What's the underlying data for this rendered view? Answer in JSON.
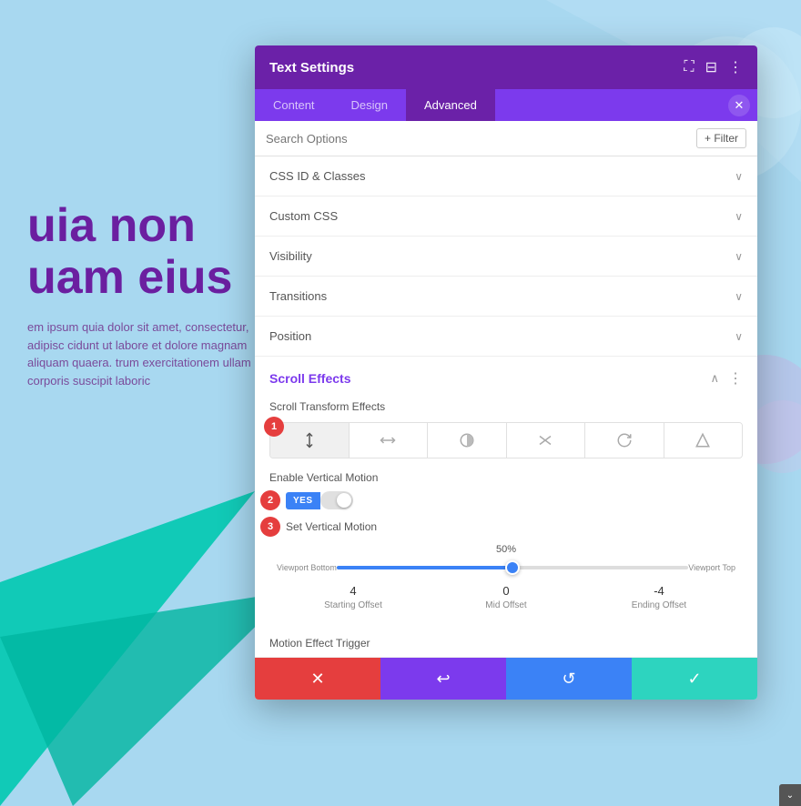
{
  "background": {
    "color": "#a8d8f0"
  },
  "page_text": {
    "heading_line1": "uia non",
    "heading_line2": "uam eius",
    "body": "em ipsum quia dolor sit amet, consectetur, adipisc cidunt ut labore et dolore magnam aliquam quaera. trum exercitationem ullam corporis suscipit laboric"
  },
  "modal": {
    "title": "Text Settings",
    "tabs": [
      {
        "label": "Content",
        "active": false
      },
      {
        "label": "Design",
        "active": false
      },
      {
        "label": "Advanced",
        "active": true
      }
    ],
    "search_placeholder": "Search Options",
    "filter_label": "+ Filter",
    "accordion_sections": [
      {
        "label": "CSS ID & Classes"
      },
      {
        "label": "Custom CSS"
      },
      {
        "label": "Visibility"
      },
      {
        "label": "Transitions"
      },
      {
        "label": "Position"
      }
    ],
    "scroll_effects": {
      "title": "Scroll Effects",
      "scroll_transform_label": "Scroll Transform Effects",
      "transform_icons": [
        {
          "name": "vertical-motion-icon",
          "active": true,
          "symbol": "↕"
        },
        {
          "name": "horizontal-motion-icon",
          "active": false,
          "symbol": "⇄"
        },
        {
          "name": "fade-icon",
          "active": false,
          "symbol": "◑"
        },
        {
          "name": "blur-icon",
          "active": false,
          "symbol": "⟋"
        },
        {
          "name": "rotate-icon",
          "active": false,
          "symbol": "↻"
        },
        {
          "name": "scale-icon",
          "active": false,
          "symbol": "◇"
        }
      ],
      "step_badges": [
        "1",
        "2",
        "3"
      ],
      "enable_vertical_label": "Enable Vertical Motion",
      "toggle_yes_label": "YES",
      "set_vertical_label": "Set Vertical Motion",
      "slider_percent": "50%",
      "viewport_bottom": "Viewport Bottom",
      "viewport_top": "Viewport Top",
      "starting_offset_value": "4",
      "starting_offset_label": "Starting Offset",
      "mid_offset_value": "0",
      "mid_offset_label": "Mid Offset",
      "ending_offset_value": "-4",
      "ending_offset_label": "Ending Offset",
      "motion_trigger_label": "Motion Effect Trigger"
    },
    "footer": {
      "cancel_icon": "✕",
      "undo_icon": "↩",
      "redo_icon": "↺",
      "save_icon": "✓"
    }
  }
}
